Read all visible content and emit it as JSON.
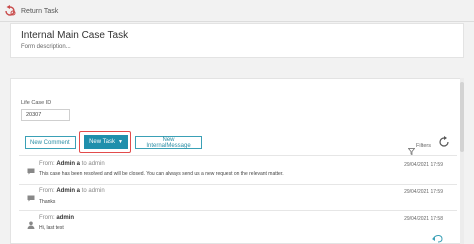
{
  "topbar": {
    "return_label": "Return Task"
  },
  "header": {
    "title": "Internal Main Case Task",
    "subtitle": "Form description..."
  },
  "life_case": {
    "label": "Life Case ID",
    "value": "20307"
  },
  "toolbar": {
    "new_comment": "New Comment",
    "new_task": "New Task",
    "new_internal": "New InternalMessage",
    "filters": "Filters"
  },
  "messages": [
    {
      "from_label": "From:",
      "sender": "Admin a",
      "to_label": "to",
      "recipient": "admin",
      "date": "29/04/2021 17:59",
      "text": "This case has been resolved and will be closed. You can always send us a new request on the relevant matter."
    },
    {
      "from_label": "From:",
      "sender": "Admin a",
      "to_label": "to",
      "recipient": "admin",
      "date": "29/04/2021 17:59",
      "text": "Thanks"
    },
    {
      "from_label": "From:",
      "sender": "admin",
      "to_label": "",
      "recipient": "",
      "date": "29/04/2021 17:58",
      "text": "Hi, last test"
    }
  ],
  "colors": {
    "accent": "#1f8fac",
    "highlight": "#e24b4b",
    "outline": "#3aa0b6"
  },
  "icons": [
    "return-icon",
    "filter-icon",
    "refresh-icon",
    "comment-icon",
    "user-icon",
    "reply-icon",
    "caret-down-icon"
  ]
}
